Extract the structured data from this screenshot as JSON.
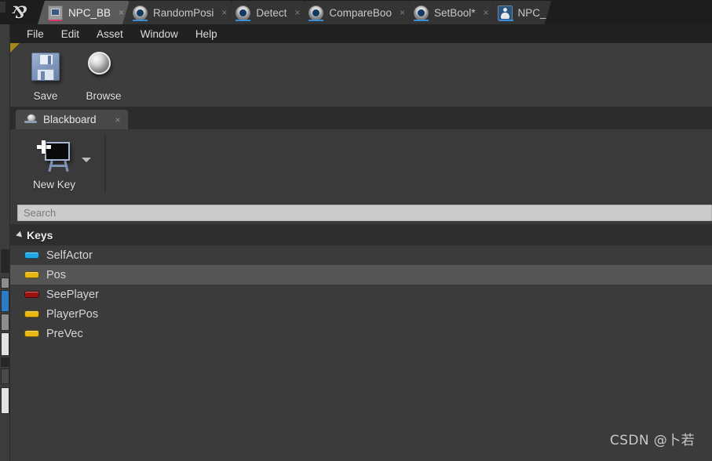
{
  "window": {
    "logo_glyph": "ȣ",
    "logo_name": "unreal-engine-logo"
  },
  "tabs": [
    {
      "label": "NPC_BB",
      "icon": "blackboard-icon",
      "active": true,
      "modified": false,
      "close": "×"
    },
    {
      "label": "RandomPosi",
      "icon": "blueprint-icon",
      "active": false,
      "modified": false,
      "close": "×"
    },
    {
      "label": "Detect",
      "icon": "blueprint-icon",
      "active": false,
      "modified": false,
      "close": "×"
    },
    {
      "label": "CompareBoo",
      "icon": "blueprint-icon",
      "active": false,
      "modified": false,
      "close": "×"
    },
    {
      "label": "SetBool*",
      "icon": "blueprint-icon",
      "active": false,
      "modified": true,
      "close": "×"
    },
    {
      "label": "NPC_",
      "icon": "pawn-icon",
      "active": false,
      "modified": false,
      "close": "×"
    }
  ],
  "menubar": {
    "items": [
      {
        "label": "File"
      },
      {
        "label": "Edit"
      },
      {
        "label": "Asset"
      },
      {
        "label": "Window"
      },
      {
        "label": "Help"
      }
    ]
  },
  "toolbar": {
    "buttons": [
      {
        "label": "Save",
        "icon": "floppy-disk-icon"
      },
      {
        "label": "Browse",
        "icon": "magnifier-icon"
      }
    ]
  },
  "panel": {
    "tab_label": "Blackboard",
    "tab_icon": "blackboard-panel-icon",
    "tab_close": "×",
    "new_key": {
      "label": "New Key",
      "icon": "new-key-board-icon",
      "has_dropdown": true
    },
    "search": {
      "placeholder": "Search",
      "value": ""
    },
    "keys_section": {
      "title": "Keys",
      "expanded": true,
      "rows": [
        {
          "name": "SelfActor",
          "type_color": "#1fa8e8",
          "selected": false
        },
        {
          "name": "Pos",
          "type_color": "#e8b712",
          "selected": true
        },
        {
          "name": "SeePlayer",
          "type_color": "#9e1212",
          "selected": false
        },
        {
          "name": "PlayerPos",
          "type_color": "#e8b712",
          "selected": false
        },
        {
          "name": "PreVec",
          "type_color": "#e8b712",
          "selected": false
        }
      ]
    }
  },
  "watermark": {
    "text": "CSDN @卜若"
  },
  "colors": {
    "tabbar_bg": "#1d1d1d",
    "menubar_bg": "#212121",
    "toolbar_bg": "#3d3d3d",
    "panel_bg": "#3b3b3b",
    "active_tab_bg": "#5b5b5b",
    "selection_bg": "#555555",
    "accent_marker": "#a8861a"
  }
}
